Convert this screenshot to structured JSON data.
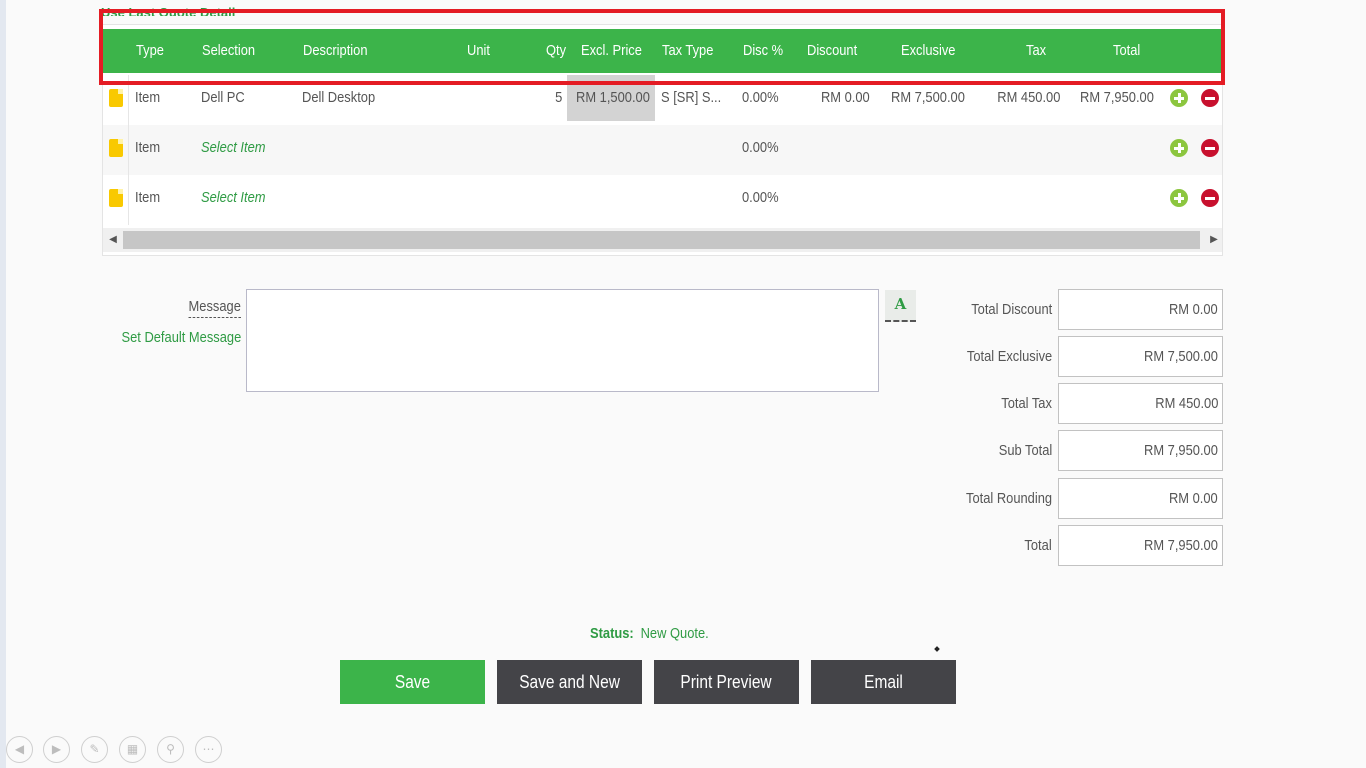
{
  "top_link": "Use Last Quote Detail",
  "table": {
    "headers": [
      "Type",
      "Selection",
      "Description",
      "Unit",
      "Qty",
      "Excl. Price",
      "Tax Type",
      "Disc %",
      "Discount",
      "Exclusive",
      "Tax",
      "Total"
    ],
    "rows": [
      {
        "type": "Item",
        "selection": "Dell PC",
        "description": "Dell Desktop",
        "unit": "",
        "qty": "5",
        "excl_price": "RM 1,500.00",
        "tax_type": "S [SR] S...",
        "disc_pct": "0.00%",
        "discount": "RM 0.00",
        "exclusive": "RM 7,500.00",
        "tax": "RM 450.00",
        "total": "RM 7,950.00"
      },
      {
        "type": "Item",
        "selection": "Select Item",
        "description": "",
        "unit": "",
        "qty": "",
        "excl_price": "",
        "tax_type": "",
        "disc_pct": "0.00%",
        "discount": "",
        "exclusive": "",
        "tax": "",
        "total": ""
      },
      {
        "type": "Item",
        "selection": "Select Item",
        "description": "",
        "unit": "",
        "qty": "",
        "excl_price": "",
        "tax_type": "",
        "disc_pct": "0.00%",
        "discount": "",
        "exclusive": "",
        "tax": "",
        "total": ""
      }
    ]
  },
  "message": {
    "label": "Message",
    "set_default": "Set Default Message",
    "value": "",
    "font_button": "A"
  },
  "totals": [
    {
      "label": "Total Discount",
      "value": "RM 0.00"
    },
    {
      "label": "Total Exclusive",
      "value": "RM 7,500.00"
    },
    {
      "label": "Total Tax",
      "value": "RM 450.00"
    },
    {
      "label": "Sub Total",
      "value": "RM 7,950.00"
    },
    {
      "label": "Total Rounding",
      "value": "RM 0.00"
    },
    {
      "label": "Total",
      "value": "RM 7,950.00"
    }
  ],
  "status": {
    "label": "Status:",
    "value": "New Quote."
  },
  "buttons": {
    "save": "Save",
    "save_and_new": "Save and New",
    "print_preview": "Print Preview",
    "email": "Email"
  },
  "colors": {
    "accent_green": "#3cb44a",
    "dark_button": "#444448",
    "annotation_red": "#e41c24",
    "delete_red": "#c8102e"
  }
}
